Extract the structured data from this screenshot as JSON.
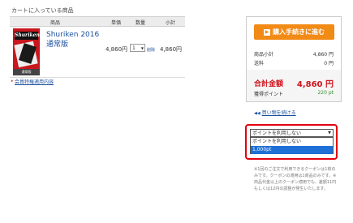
{
  "cart": {
    "title": "カートに入っている商品",
    "headers": {
      "product": "商品",
      "unit_price": "単価",
      "quantity": "数量",
      "subtotal": "小計"
    },
    "item": {
      "thumb_title": "Shuriken",
      "thumb_badge": "通常版",
      "name_line1": "Shuriken 2016",
      "name_line2": "通常版",
      "price": "4,860円",
      "quantity": "1",
      "delete": "削除",
      "subtotal": "4,860円"
    },
    "member_link": "会員特権適用内容"
  },
  "summary": {
    "checkout_label": "購入手続きに進む",
    "rows": [
      {
        "label": "商品小計",
        "value": "4,860 円"
      },
      {
        "label": "送料",
        "value": "0 円"
      }
    ],
    "total_label": "合計金額",
    "total_value": "4,860 円",
    "points_label": "獲得ポイント",
    "points_value": "220 pt",
    "back_link": "買い物を続ける"
  },
  "points_select": {
    "selected": "ポイントを利用しない",
    "options": [
      "ポイントを利用しない",
      "1,000pt"
    ]
  },
  "note": "※1回のご注文で利用できるクーポンは1枚のみです。クーポンの適用は1商品のみです。※商品代金以上のクーポン適用でも、差額11円もしくは12円の調整が発生いたします。"
}
